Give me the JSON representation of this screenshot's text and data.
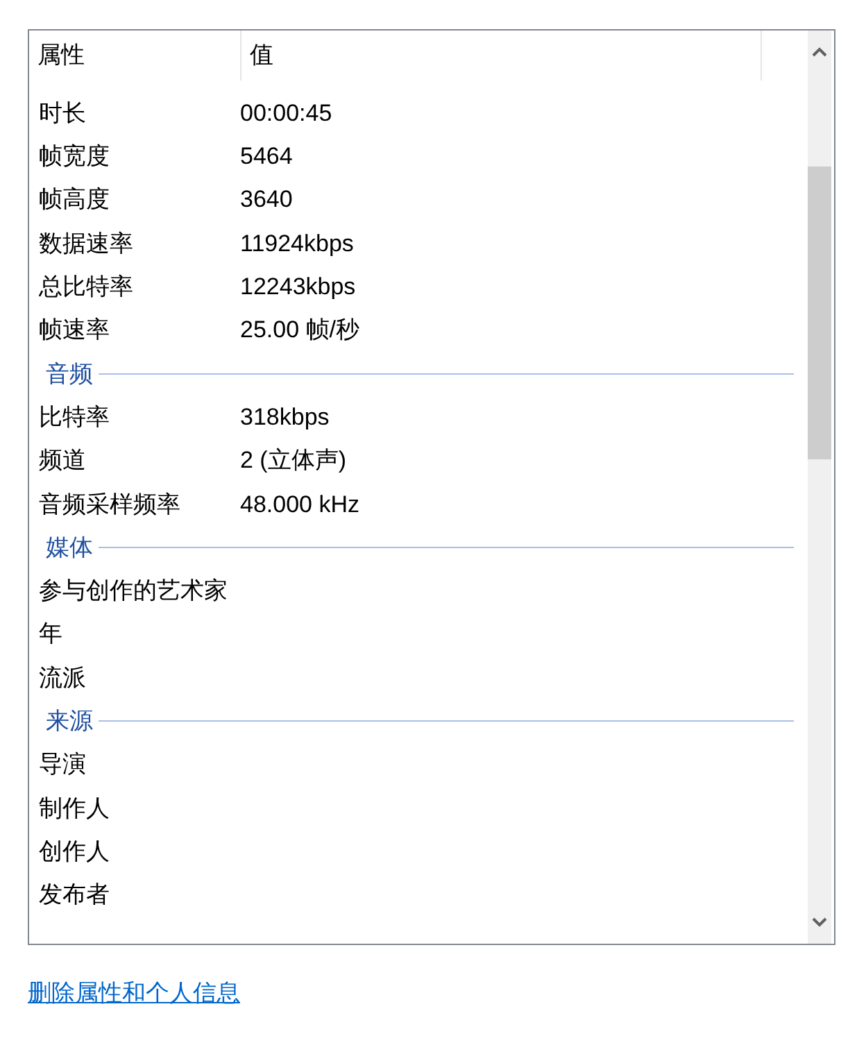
{
  "table": {
    "columns": [
      "属性",
      "值"
    ],
    "rows": [
      {
        "kind": "row",
        "name": "时长",
        "value": "00:00:45"
      },
      {
        "kind": "row",
        "name": "帧宽度",
        "value": "5464"
      },
      {
        "kind": "row",
        "name": "帧高度",
        "value": "3640"
      },
      {
        "kind": "row",
        "name": "数据速率",
        "value": "11924kbps"
      },
      {
        "kind": "row",
        "name": "总比特率",
        "value": "12243kbps"
      },
      {
        "kind": "row",
        "name": "帧速率",
        "value": "25.00 帧/秒"
      },
      {
        "kind": "group",
        "name": "音频"
      },
      {
        "kind": "row",
        "name": "比特率",
        "value": "318kbps"
      },
      {
        "kind": "row",
        "name": "频道",
        "value": "2 (立体声)"
      },
      {
        "kind": "row",
        "name": "音频采样频率",
        "value": "48.000 kHz"
      },
      {
        "kind": "group",
        "name": "媒体"
      },
      {
        "kind": "row",
        "name": "参与创作的艺术家"
      },
      {
        "kind": "row",
        "name": "年"
      },
      {
        "kind": "row",
        "name": "流派"
      },
      {
        "kind": "group",
        "name": "来源"
      },
      {
        "kind": "row",
        "name": "导演"
      },
      {
        "kind": "row",
        "name": "制作人"
      },
      {
        "kind": "row",
        "name": "创作人"
      },
      {
        "kind": "row",
        "name": "发布者"
      }
    ]
  },
  "link": "删除属性和个人信息"
}
